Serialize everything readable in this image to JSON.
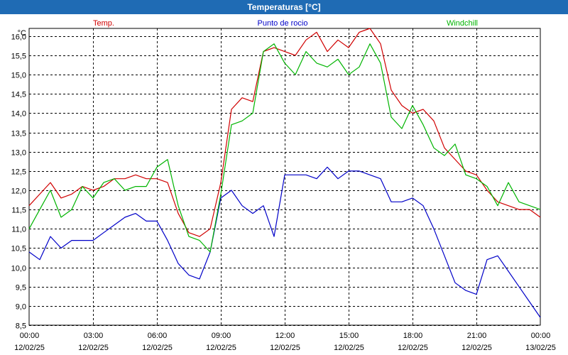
{
  "window": {
    "title": "Temperaturas [°C]"
  },
  "chart_data": {
    "type": "line",
    "title": "Temperaturas [°C]",
    "ylabel": "°C",
    "ylim": [
      8.5,
      16.2
    ],
    "grid": true,
    "legend": "top",
    "y_ticks": [
      "8,5",
      "9,0",
      "9,5",
      "10,0",
      "10,5",
      "11,0",
      "11,5",
      "12,0",
      "12,5",
      "13,0",
      "13,5",
      "14,0",
      "14,5",
      "15,0",
      "15,5",
      "16,0"
    ],
    "x_ticks": [
      {
        "time": "00:00",
        "date": "12/02/25"
      },
      {
        "time": "03:00",
        "date": "12/02/25"
      },
      {
        "time": "06:00",
        "date": "12/02/25"
      },
      {
        "time": "09:00",
        "date": "12/02/25"
      },
      {
        "time": "12:00",
        "date": "12/02/25"
      },
      {
        "time": "15:00",
        "date": "12/02/25"
      },
      {
        "time": "18:00",
        "date": "12/02/25"
      },
      {
        "time": "21:00",
        "date": "12/02/25"
      },
      {
        "time": "00:00",
        "date": "13/02/25"
      }
    ],
    "x_hours": [
      0,
      0.5,
      1,
      1.5,
      2,
      2.5,
      3,
      3.5,
      4,
      4.5,
      5,
      5.5,
      6,
      6.5,
      7,
      7.5,
      8,
      8.5,
      9,
      9.5,
      10,
      10.5,
      11,
      11.5,
      12,
      12.5,
      13,
      13.5,
      14,
      14.5,
      15,
      15.5,
      16,
      16.5,
      17,
      17.5,
      18,
      18.5,
      19,
      19.5,
      20,
      20.5,
      21,
      21.5,
      22,
      22.5,
      23,
      23.5,
      24
    ],
    "series": [
      {
        "name": "Temp.",
        "color": "#d00000",
        "values": [
          11.6,
          11.9,
          12.2,
          11.8,
          11.9,
          12.1,
          12.0,
          12.1,
          12.3,
          12.3,
          12.4,
          12.3,
          12.3,
          12.2,
          11.4,
          10.9,
          10.8,
          11.0,
          12.2,
          14.1,
          14.4,
          14.3,
          15.6,
          15.7,
          15.6,
          15.5,
          15.9,
          16.1,
          15.6,
          15.9,
          15.7,
          16.1,
          16.2,
          15.8,
          14.6,
          14.2,
          14.0,
          14.1,
          13.8,
          13.1,
          12.8,
          12.5,
          12.4,
          12.0,
          11.7,
          11.6,
          11.5,
          11.5,
          11.3
        ]
      },
      {
        "name": "Punto de rocio",
        "color": "#0000c8",
        "values": [
          10.4,
          10.2,
          10.8,
          10.5,
          10.7,
          10.7,
          10.7,
          10.9,
          11.1,
          11.3,
          11.4,
          11.2,
          11.2,
          10.7,
          10.1,
          9.8,
          9.7,
          10.4,
          11.8,
          12.0,
          11.6,
          11.4,
          11.6,
          10.8,
          12.4,
          12.4,
          12.4,
          12.3,
          12.6,
          12.3,
          12.5,
          12.5,
          12.4,
          12.3,
          11.7,
          11.7,
          11.8,
          11.6,
          11.0,
          10.3,
          9.6,
          9.4,
          9.3,
          10.2,
          10.3,
          9.9,
          9.5,
          9.1,
          8.7
        ]
      },
      {
        "name": "Windchill",
        "color": "#00b400",
        "values": [
          11.0,
          11.5,
          12.0,
          11.3,
          11.5,
          12.1,
          11.8,
          12.2,
          12.3,
          12.0,
          12.1,
          12.1,
          12.6,
          12.8,
          11.6,
          10.8,
          10.7,
          10.4,
          11.9,
          13.7,
          13.8,
          14.0,
          15.6,
          15.8,
          15.3,
          15.0,
          15.6,
          15.3,
          15.2,
          15.4,
          15.0,
          15.2,
          15.8,
          15.3,
          13.9,
          13.6,
          14.2,
          13.7,
          13.1,
          12.9,
          13.2,
          12.4,
          12.3,
          12.1,
          11.6,
          12.2,
          11.7,
          11.6,
          11.5
        ]
      }
    ]
  }
}
